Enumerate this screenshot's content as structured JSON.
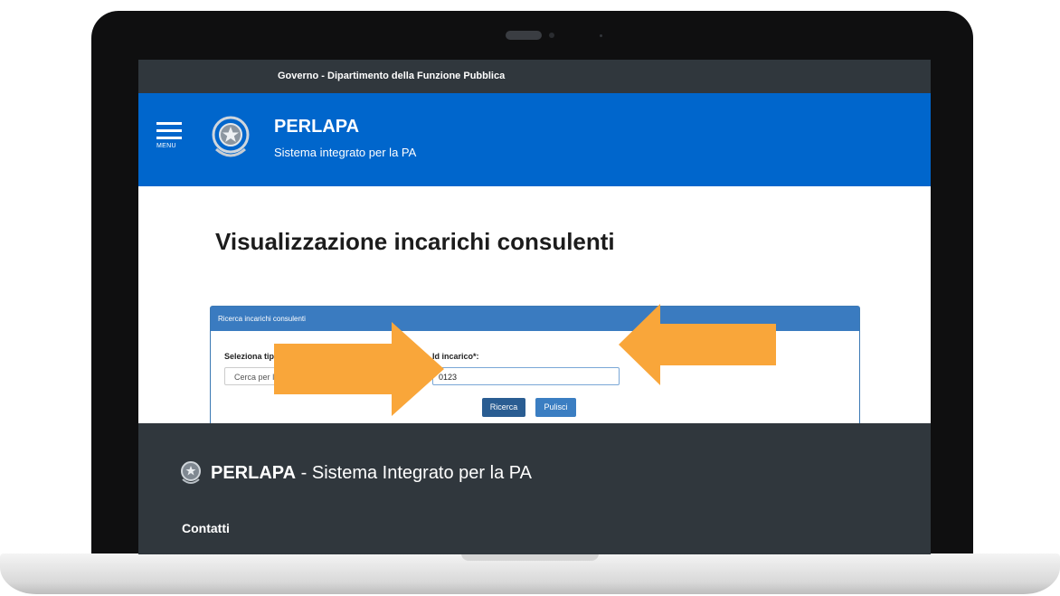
{
  "topbar": {
    "governo": "Governo",
    "dipartimento": "- Dipartimento della Funzione Pubblica"
  },
  "header": {
    "menu_label": "MENU",
    "brand_title": "PERLAPA",
    "brand_subtitle": "Sistema integrato per la PA"
  },
  "main": {
    "page_title": "Visualizzazione incarichi consulenti",
    "panel_title": "Ricerca incarichi consulenti",
    "select_label": "Seleziona tipologia di ricerca",
    "select_value": "Cerca per Id Incarico",
    "id_label": "Id incarico*:",
    "id_value": "0123",
    "search_button": "Ricerca",
    "clear_button": "Pulisci"
  },
  "footer": {
    "brand_bold": "PERLAPA",
    "brand_rest": " - Sistema Integrato per la PA",
    "contacts": "Contatti"
  },
  "colors": {
    "header_blue": "#0066cc",
    "topbar_dark": "#30373d",
    "arrow_orange": "#f9a63a"
  },
  "icons": [
    "hamburger-menu-icon",
    "republic-emblem-icon",
    "select-caret-icon"
  ]
}
